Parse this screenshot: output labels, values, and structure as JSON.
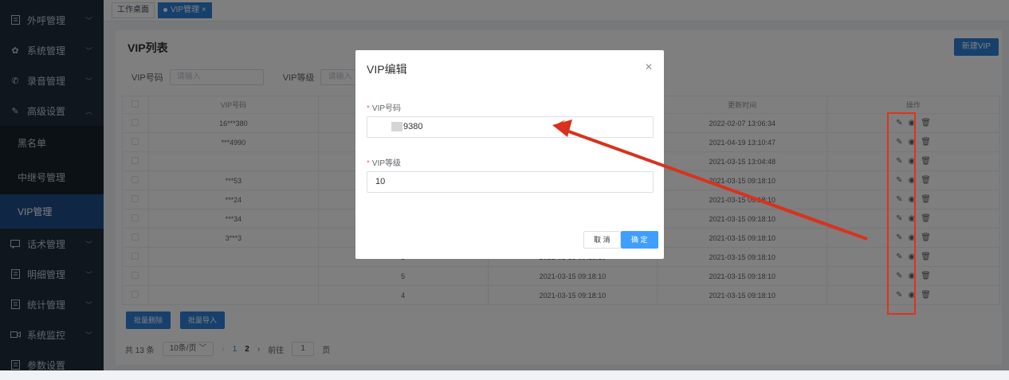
{
  "sidebar": {
    "items": [
      {
        "label": "外呼管理",
        "icon": "doc-icon"
      },
      {
        "label": "系统管理",
        "icon": "gear-icon"
      },
      {
        "label": "录音管理",
        "icon": "phone-icon"
      },
      {
        "label": "高级设置",
        "icon": "pen-icon"
      }
    ],
    "sub_items": [
      "黑名单",
      "中继号管理",
      "VIP管理"
    ],
    "items_after": [
      {
        "label": "话术管理",
        "icon": "chat-icon"
      },
      {
        "label": "明细管理",
        "icon": "doc-icon"
      },
      {
        "label": "统计管理",
        "icon": "doc-icon"
      },
      {
        "label": "系统监控",
        "icon": "camera-icon"
      },
      {
        "label": "参数设置",
        "icon": "doc-icon"
      }
    ]
  },
  "tabs": [
    {
      "label": "工作桌面"
    },
    {
      "label": "VIP管理 ×"
    }
  ],
  "main": {
    "title": "VIP列表",
    "new_button": "新建VIP",
    "search": {
      "vip_number_label": "VIP号码",
      "vip_number_placeholder": "请输入",
      "vip_level_label": "VIP等级",
      "vip_level_placeholder": "请输入"
    },
    "columns": [
      "VIP号码",
      "",
      "",
      "更新时间",
      "操作"
    ],
    "rows": [
      {
        "num": "16***380",
        "level": "",
        "created": "",
        "updated": "2022-02-07 13:06:34"
      },
      {
        "num": "***4990",
        "level": "",
        "created": "",
        "updated": "2021-04-19 13:10:47"
      },
      {
        "num": "",
        "level": "",
        "created": "",
        "updated": "2021-03-15 13:04:48"
      },
      {
        "num": "***53",
        "level": "",
        "created": "",
        "updated": "2021-03-15 09:18:10"
      },
      {
        "num": "***24",
        "level": "",
        "created": "",
        "updated": "2021-03-15 09:18:10"
      },
      {
        "num": "***34",
        "level": "",
        "created": "",
        "updated": "2021-03-15 09:18:10"
      },
      {
        "num": "3***3",
        "level": "",
        "created": "",
        "updated": "2021-03-15 09:18:10"
      },
      {
        "num": "",
        "level": "5",
        "created": "2021-03-15 09:18:10",
        "updated": "2021-03-15 09:18:10"
      },
      {
        "num": "",
        "level": "5",
        "created": "2021-03-15 09:18:10",
        "updated": "2021-03-15 09:18:10"
      },
      {
        "num": "",
        "level": "4",
        "created": "2021-03-15 09:18:10",
        "updated": "2021-03-15 09:18:10"
      }
    ],
    "batch_delete": "批量删除",
    "batch_import": "批量导入",
    "pager": {
      "total": "共 13 条",
      "page_size": "10条/页",
      "page1": "1",
      "page2": "2",
      "goto_label": "前往",
      "goto_value": "1",
      "page_unit": "页"
    }
  },
  "dialog": {
    "title": "VIP编辑",
    "vip_number_label": "VIP号码",
    "vip_number_value": "9380",
    "vip_level_label": "VIP等级",
    "vip_level_value": "10",
    "cancel": "取 消",
    "confirm": "确 定"
  }
}
